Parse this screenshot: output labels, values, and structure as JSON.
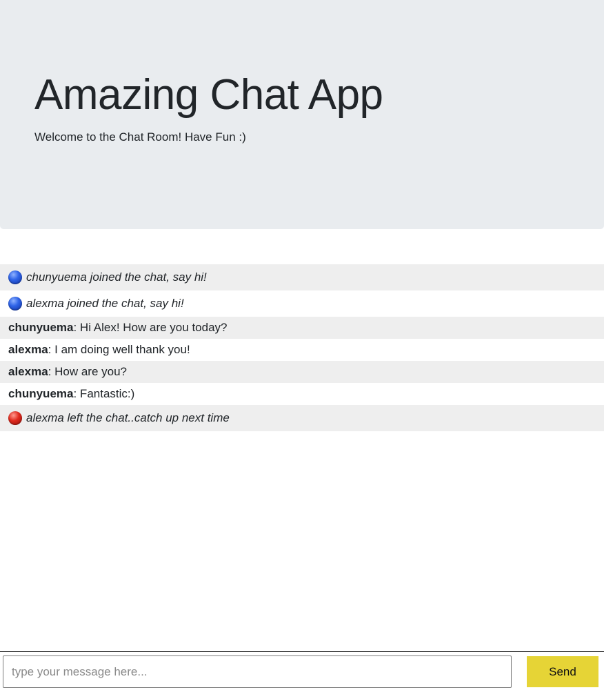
{
  "header": {
    "title": "Amazing Chat App",
    "subtitle": "Welcome to the Chat Room! Have Fun :)"
  },
  "messages": [
    {
      "type": "event",
      "icon": "blue-circle-icon",
      "text": "chunyuema joined the chat, say hi!"
    },
    {
      "type": "event",
      "icon": "blue-circle-icon",
      "text": "alexma joined the chat, say hi!"
    },
    {
      "type": "chat",
      "user": "chunyuema",
      "text": ": Hi Alex! How are you today?"
    },
    {
      "type": "chat",
      "user": "alexma",
      "text": ": I am doing well thank you!"
    },
    {
      "type": "chat",
      "user": "alexma",
      "text": ": How are you?"
    },
    {
      "type": "chat",
      "user": "chunyuema",
      "text": ": Fantastic:)"
    },
    {
      "type": "event",
      "icon": "red-circle-icon",
      "text": "alexma left the chat..catch up next time"
    }
  ],
  "composer": {
    "placeholder": "type your message here...",
    "value": "",
    "send_label": "Send"
  },
  "colors": {
    "jumbotron_bg": "#e9ecef",
    "alt_row_bg": "#eeeeee",
    "send_button_bg": "#e6d436",
    "join_dot": "#2f64e8",
    "leave_dot": "#e02a1e"
  }
}
